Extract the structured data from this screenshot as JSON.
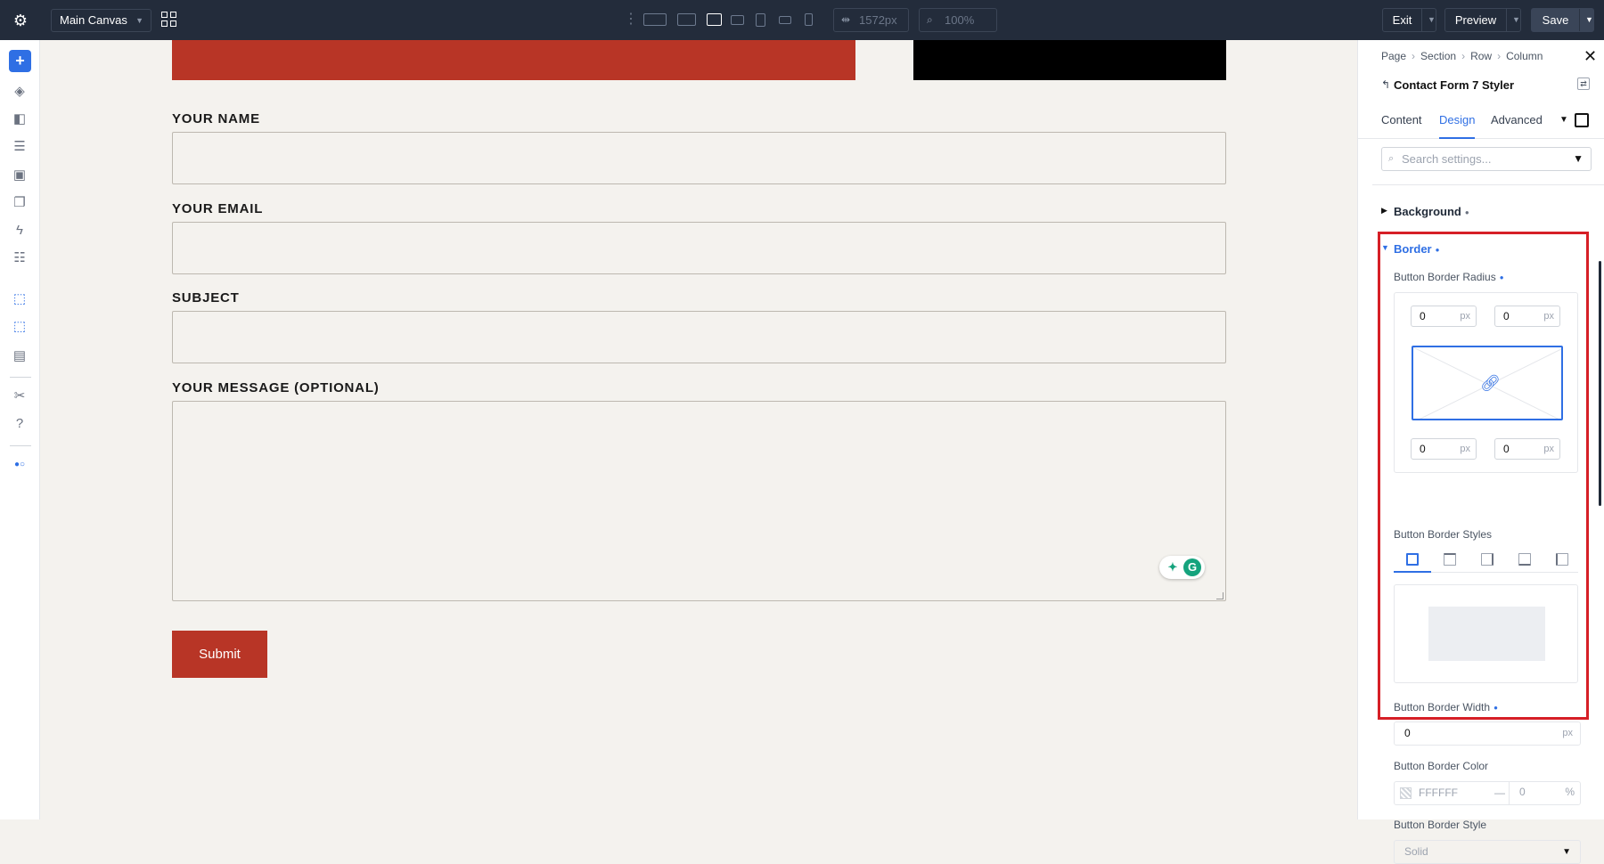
{
  "toolbar": {
    "canvas_select": "Main Canvas",
    "width_value": "1572px",
    "zoom_value": "100%",
    "exit_label": "Exit",
    "preview_label": "Preview",
    "save_label": "Save",
    "devices": [
      "desktop-wide",
      "desktop",
      "laptop",
      "tablet-landscape",
      "tablet",
      "phone-landscape",
      "phone"
    ],
    "active_device": "laptop"
  },
  "sidebar": {
    "icons": [
      "add-icon",
      "layers-icon",
      "theme-icon",
      "database-icon",
      "form-icon",
      "pages-icon",
      "lightning-icon",
      "layout-icon",
      "cursor-icon",
      "cursor-multi-icon",
      "template-icon",
      "tools-icon",
      "help-icon",
      "toggle-icon"
    ]
  },
  "form": {
    "name_label": "YOUR NAME",
    "email_label": "YOUR EMAIL",
    "subject_label": "SUBJECT",
    "message_label": "YOUR MESSAGE (OPTIONAL)",
    "submit_label": "Submit"
  },
  "panel": {
    "breadcrumb": [
      "Page",
      "Section",
      "Row",
      "Column"
    ],
    "module_title": "Contact Form 7 Styler",
    "tabs": [
      "Content",
      "Design",
      "Advanced"
    ],
    "active_tab": "Design",
    "search_placeholder": "Search settings...",
    "background_label": "Background",
    "border_label": "Border",
    "radius_label": "Button Border Radius",
    "radius_values": {
      "tl": "0",
      "tr": "0",
      "bl": "0",
      "br": "0"
    },
    "unit": "px",
    "styles_label": "Button Border Styles",
    "width_label": "Button Border Width",
    "width_value": "0",
    "color_label": "Button Border Color",
    "color_hex": "FFFFFF",
    "color_dash": "—",
    "color_opacity": "0",
    "percent": "%",
    "style_label": "Button Border Style",
    "style_value": "Solid"
  },
  "colors": {
    "accent": "#2f6fe4",
    "brand_red": "#b83526",
    "topbar": "#232c3b",
    "highlight": "#d61f26"
  }
}
